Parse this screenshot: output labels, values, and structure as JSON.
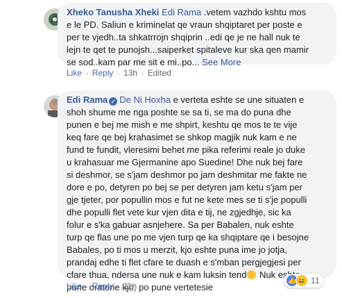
{
  "comments": [
    {
      "author": "Xheko Tanusha Xheki",
      "mention": "Edi Rama",
      "text": " .vetem vazhdo kshtu mos\ne le PD. Saliun e kriminelat qe vraun shqiptaret per poste e\nper te vjedh..ta shkatrrojn shqiprin ..edi qe je ne hall nuk te\nlejn te qet te punojsh...saiperket spitaleve kur ska qen mamir\nse sod..kam par me sit e mi..po...",
      "see_more": " See More",
      "like": "Like",
      "reply": "Reply",
      "time": "13h",
      "edited": "Edited"
    },
    {
      "author": "Edi Rama",
      "verified_icon": "verified-badge-icon",
      "mention": "De Ni Hoxha",
      "text": " e verteta eshte se une situaten e\nshoh shume me nga poshte se sa ti, se ma do puna dhe\npunen e bej me mish e me shpirt, keshtu qe mos te te vije\nkeq fare qe bej krahasimet se shkop magjik nuk kam e ne\nfund te fundit, vleresimi behet me pika referimi reale jo duke\nu krahasuar me Gjermanine apo Suedine! Dhe nuk bej fare\nsi deshmor, se s'jam deshmor po jam deshmitar me fakte ne\ndore e po, detyren po bej se per detyren jam ketu s'jam per\ngje tjeter, por popullin mos e fut ne kete mes se ti s'je populli\ndhe populli flet vete kur vjen dita e tij, ne zgjedhje, sic ka\nfolur e s'ka gabuar asnjehere. Sa per Babalen, nuk eshte\nturp qe flas une po me vjen turp qe ka shqiptare qe i besojne\nBabales, po ti mos u merzit, kjo eshte puna ime jo jotja,\nprandaj edhe ti flet cfare te duash e s'mban pergjegjesi per\ncfare thua, ndersa une nuk e kam luksin tend",
      "text_tail": "  Nuk eshte\npune oratorie kjo, po pune vertetesie",
      "like": "Like",
      "reply": "Reply",
      "time": "11h",
      "reaction_count": "11"
    }
  ]
}
